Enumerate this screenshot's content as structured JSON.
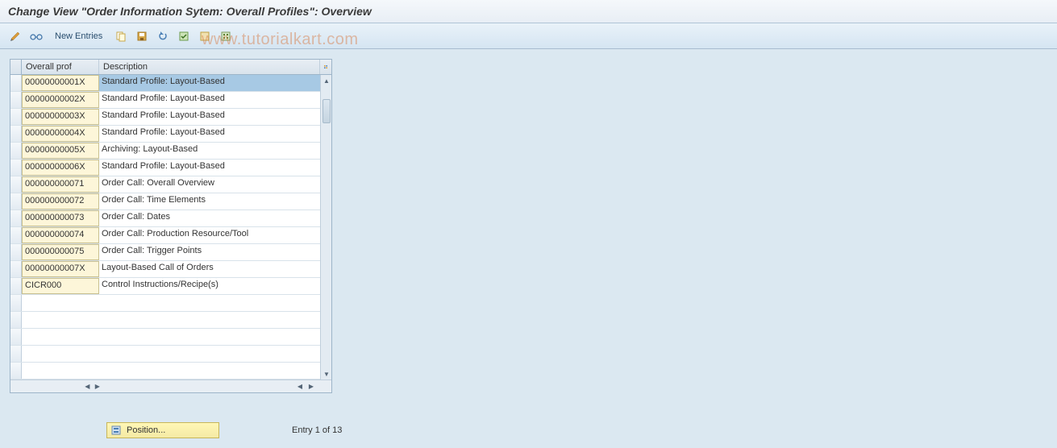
{
  "title": "Change View \"Order Information Sytem: Overall Profiles\": Overview",
  "toolbar": {
    "new_entries": "New Entries"
  },
  "table": {
    "headers": {
      "prof": "Overall prof",
      "desc": "Description"
    },
    "rows": [
      {
        "prof": "00000000001X",
        "desc": "Standard Profile: Layout-Based",
        "selected": true
      },
      {
        "prof": "00000000002X",
        "desc": "Standard Profile: Layout-Based"
      },
      {
        "prof": "00000000003X",
        "desc": "Standard Profile: Layout-Based"
      },
      {
        "prof": "00000000004X",
        "desc": "Standard Profile: Layout-Based"
      },
      {
        "prof": "00000000005X",
        "desc": "Archiving: Layout-Based"
      },
      {
        "prof": "00000000006X",
        "desc": "Standard Profile: Layout-Based"
      },
      {
        "prof": "000000000071",
        "desc": "Order Call: Overall Overview"
      },
      {
        "prof": "000000000072",
        "desc": "Order Call: Time Elements"
      },
      {
        "prof": "000000000073",
        "desc": "Order Call: Dates"
      },
      {
        "prof": "000000000074",
        "desc": "Order Call: Production Resource/Tool"
      },
      {
        "prof": "000000000075",
        "desc": "Order Call: Trigger Points"
      },
      {
        "prof": "00000000007X",
        "desc": "Layout-Based Call of Orders"
      },
      {
        "prof": "CICR000",
        "desc": "Control Instructions/Recipe(s)"
      }
    ]
  },
  "footer": {
    "position_label": "Position...",
    "entry_text": "Entry 1 of 13"
  },
  "watermark": "www.tutorialkart.com"
}
